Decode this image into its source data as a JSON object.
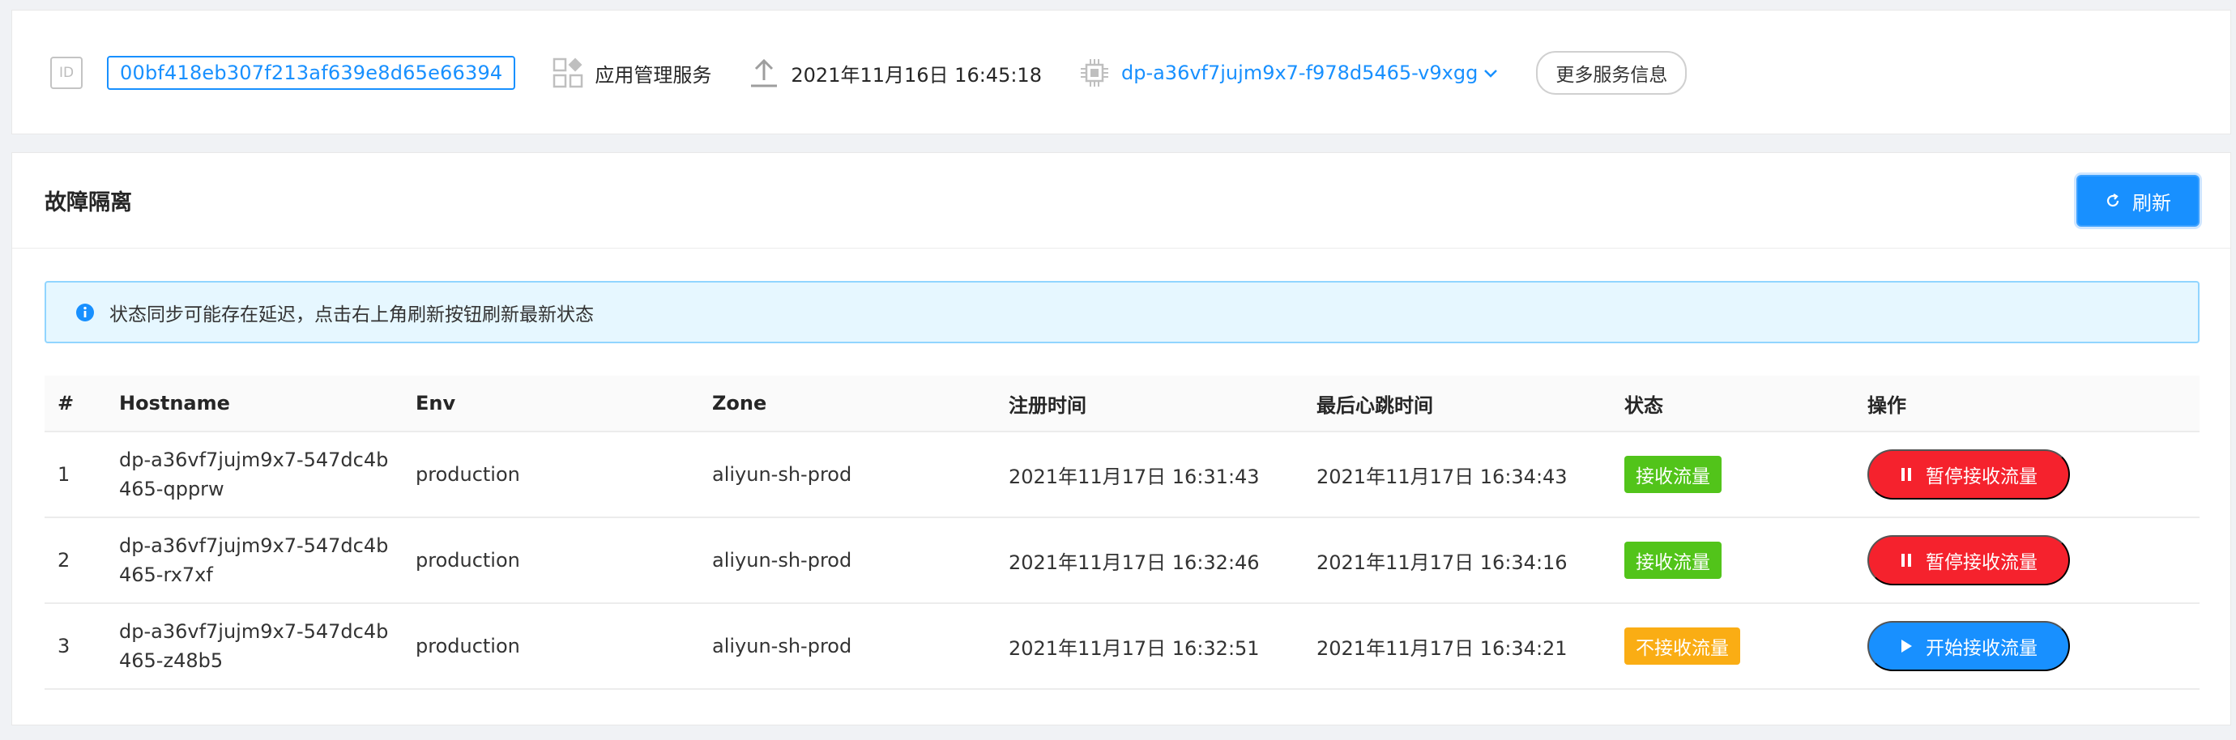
{
  "info": {
    "id_icon_text": "ID",
    "service_id": "00bf418eb307f213af639e8d65e66394",
    "service_type": "应用管理服务",
    "deploy_time": "2021年11月16日 16:45:18",
    "instance": "dp-a36vf7jujm9x7-f978d5465-v9xgg",
    "more_button": "更多服务信息"
  },
  "panel": {
    "title": "故障隔离",
    "refresh_label": "刷新",
    "alert_text": "状态同步可能存在延迟，点击右上角刷新按钮刷新最新状态"
  },
  "table": {
    "columns": [
      "#",
      "Hostname",
      "Env",
      "Zone",
      "注册时间",
      "最后心跳时间",
      "状态",
      "操作"
    ],
    "rows": [
      {
        "index": "1",
        "hostname_line1": "dp-a36vf7jujm9x7-547dc4b",
        "hostname_line2": "465-qpprw",
        "env": "production",
        "zone": "aliyun-sh-prod",
        "register_time": "2021年11月17日 16:31:43",
        "heartbeat_time": "2021年11月17日 16:34:43",
        "status": "接收流量",
        "action": "暂停接收流量"
      },
      {
        "index": "2",
        "hostname_line1": "dp-a36vf7jujm9x7-547dc4b",
        "hostname_line2": "465-rx7xf",
        "env": "production",
        "zone": "aliyun-sh-prod",
        "register_time": "2021年11月17日 16:32:46",
        "heartbeat_time": "2021年11月17日 16:34:16",
        "status": "接收流量",
        "action": "暂停接收流量"
      },
      {
        "index": "3",
        "hostname_line1": "dp-a36vf7jujm9x7-547dc4b",
        "hostname_line2": "465-z48b5",
        "env": "production",
        "zone": "aliyun-sh-prod",
        "register_time": "2021年11月17日 16:32:51",
        "heartbeat_time": "2021年11月17日 16:34:21",
        "status": "不接收流量",
        "action": "开始接收流量"
      }
    ]
  },
  "colors": {
    "primary": "#1890ff",
    "success": "#52c41a",
    "warning": "#faad14",
    "danger": "#f5222d"
  },
  "icons": {
    "id": "id-icon",
    "service_type": "grid-apps-icon",
    "deploy_time": "upload-icon",
    "instance": "chip-icon",
    "instance_dropdown": "chevron-down-icon",
    "refresh": "refresh-icon",
    "alert": "info-circle-icon",
    "pause": "pause-icon",
    "play": "play-icon"
  }
}
